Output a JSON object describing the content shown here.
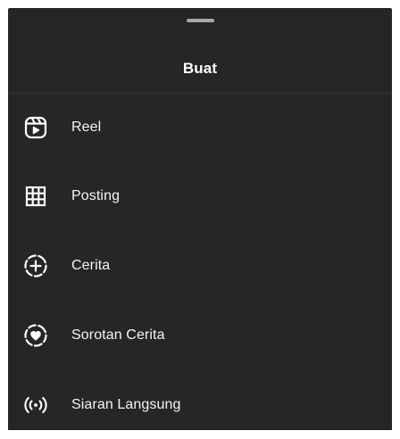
{
  "sheet": {
    "title": "Buat"
  },
  "menu": {
    "items": [
      {
        "label": "Reel",
        "icon": "reels-icon"
      },
      {
        "label": "Posting",
        "icon": "grid-post-icon"
      },
      {
        "label": "Cerita",
        "icon": "story-add-icon"
      },
      {
        "label": "Sorotan Cerita",
        "icon": "highlight-heart-icon"
      },
      {
        "label": "Siaran Langsung",
        "icon": "live-broadcast-icon"
      }
    ]
  },
  "colors": {
    "background": "#262626",
    "text": "#ffffff",
    "handle": "#a8a8a8",
    "divider": "#363636"
  }
}
